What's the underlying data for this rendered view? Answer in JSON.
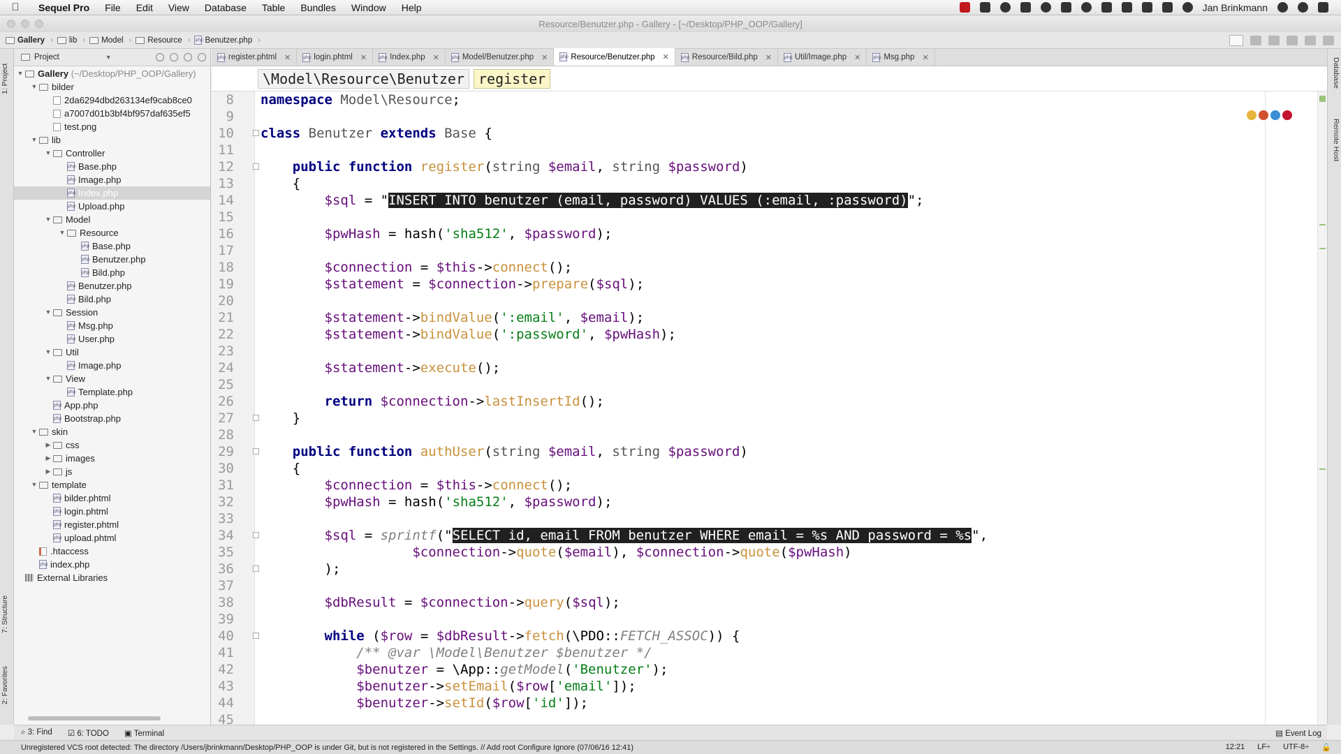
{
  "menubar": {
    "app_name": "Sequel Pro",
    "items": [
      "File",
      "Edit",
      "View",
      "Database",
      "Table",
      "Bundles",
      "Window",
      "Help"
    ],
    "user": "Jan Brinkmann"
  },
  "window": {
    "title": "Resource/Benutzer.php - Gallery - [~/Desktop/PHP_OOP/Gallery]"
  },
  "navbar": {
    "crumbs": [
      "Gallery",
      "lib",
      "Model",
      "Resource",
      "Benutzer.php"
    ]
  },
  "project": {
    "header": "Project",
    "root_label": "Gallery",
    "root_path": "(~/Desktop/PHP_OOP/Gallery)",
    "items": [
      {
        "label": "bilder",
        "kind": "folder",
        "arrow": "open"
      },
      {
        "label": "2da6294dbd263134ef9cab8ce0",
        "kind": "image",
        "arrow": ""
      },
      {
        "label": "a7007d01b3bf4bf957daf635ef5",
        "kind": "image",
        "arrow": ""
      },
      {
        "label": "test.png",
        "kind": "image",
        "arrow": ""
      },
      {
        "label": "lib",
        "kind": "folder",
        "arrow": "open"
      },
      {
        "label": "Controller",
        "kind": "folder",
        "arrow": "open"
      },
      {
        "label": "Base.php",
        "kind": "php",
        "arrow": ""
      },
      {
        "label": "Image.php",
        "kind": "php",
        "arrow": ""
      },
      {
        "label": "Index.php",
        "kind": "php",
        "arrow": ""
      },
      {
        "label": "Upload.php",
        "kind": "php",
        "arrow": ""
      },
      {
        "label": "Model",
        "kind": "folder",
        "arrow": "open"
      },
      {
        "label": "Resource",
        "kind": "folder",
        "arrow": "open"
      },
      {
        "label": "Base.php",
        "kind": "php",
        "arrow": ""
      },
      {
        "label": "Benutzer.php",
        "kind": "php",
        "arrow": ""
      },
      {
        "label": "Bild.php",
        "kind": "php",
        "arrow": ""
      },
      {
        "label": "Benutzer.php",
        "kind": "php",
        "arrow": ""
      },
      {
        "label": "Bild.php",
        "kind": "php",
        "arrow": ""
      },
      {
        "label": "Session",
        "kind": "folder",
        "arrow": "open"
      },
      {
        "label": "Msg.php",
        "kind": "php",
        "arrow": ""
      },
      {
        "label": "User.php",
        "kind": "php",
        "arrow": ""
      },
      {
        "label": "Util",
        "kind": "folder",
        "arrow": "open"
      },
      {
        "label": "Image.php",
        "kind": "php",
        "arrow": ""
      },
      {
        "label": "View",
        "kind": "folder",
        "arrow": "open"
      },
      {
        "label": "Template.php",
        "kind": "php",
        "arrow": ""
      },
      {
        "label": "App.php",
        "kind": "php",
        "arrow": ""
      },
      {
        "label": "Bootstrap.php",
        "kind": "php",
        "arrow": ""
      },
      {
        "label": "skin",
        "kind": "folder",
        "arrow": "open"
      },
      {
        "label": "css",
        "kind": "folder",
        "arrow": "closed"
      },
      {
        "label": "images",
        "kind": "folder",
        "arrow": "closed"
      },
      {
        "label": "js",
        "kind": "folder",
        "arrow": "closed"
      },
      {
        "label": "template",
        "kind": "folder",
        "arrow": "open"
      },
      {
        "label": "bilder.phtml",
        "kind": "php",
        "arrow": ""
      },
      {
        "label": "login.phtml",
        "kind": "php",
        "arrow": ""
      },
      {
        "label": "register.phtml",
        "kind": "php",
        "arrow": ""
      },
      {
        "label": "upload.phtml",
        "kind": "php",
        "arrow": ""
      },
      {
        "label": ".htaccess",
        "kind": "htaccess",
        "arrow": ""
      },
      {
        "label": "index.php",
        "kind": "php",
        "arrow": ""
      },
      {
        "label": "External Libraries",
        "kind": "ext",
        "arrow": ""
      }
    ]
  },
  "tabs": [
    {
      "label": "register.phtml"
    },
    {
      "label": "login.phtml"
    },
    {
      "label": "Index.php"
    },
    {
      "label": "Model/Benutzer.php"
    },
    {
      "label": "Resource/Benutzer.php"
    },
    {
      "label": "Resource/Bild.php"
    },
    {
      "label": "Util/Image.php"
    },
    {
      "label": "Msg.php"
    }
  ],
  "editor_breadcrumb": {
    "class_path": "\\Model\\Resource\\Benutzer",
    "method": "register"
  },
  "code": {
    "lines": [
      {
        "n": "8",
        "parts": [
          [
            "kw",
            "namespace "
          ],
          [
            "ty",
            "Model\\Resource"
          ],
          [
            "nm",
            ";"
          ]
        ]
      },
      {
        "n": "9",
        "parts": []
      },
      {
        "n": "10",
        "parts": [
          [
            "kw",
            "class "
          ],
          [
            "ty",
            "Benutzer "
          ],
          [
            "kw",
            "extends "
          ],
          [
            "ty",
            "Base "
          ],
          [
            "nm",
            "{"
          ]
        ]
      },
      {
        "n": "11",
        "parts": []
      },
      {
        "n": "12",
        "parts": [
          [
            "nm",
            "    "
          ],
          [
            "kw",
            "public function "
          ],
          [
            "fn",
            "register"
          ],
          [
            "nm",
            "("
          ],
          [
            "ty",
            "string "
          ],
          [
            "vr",
            "$email"
          ],
          [
            "nm",
            ", "
          ],
          [
            "ty",
            "string "
          ],
          [
            "vr",
            "$password"
          ],
          [
            "nm",
            ")"
          ]
        ]
      },
      {
        "n": "13",
        "parts": [
          [
            "nm",
            "    {"
          ]
        ]
      },
      {
        "n": "14",
        "parts": [
          [
            "nm",
            "        "
          ],
          [
            "vr",
            "$sql"
          ],
          [
            "nm",
            " = \""
          ],
          [
            "sel",
            "INSERT INTO benutzer (email, password) VALUES (:email, :password)"
          ],
          [
            "nm",
            "\";"
          ]
        ]
      },
      {
        "n": "15",
        "parts": []
      },
      {
        "n": "16",
        "parts": [
          [
            "nm",
            "        "
          ],
          [
            "vr",
            "$pwHash"
          ],
          [
            "nm",
            " = "
          ],
          [
            "nm",
            "hash"
          ],
          [
            "nm",
            "("
          ],
          [
            "st",
            "'sha512'"
          ],
          [
            "nm",
            ", "
          ],
          [
            "vr",
            "$password"
          ],
          [
            "nm",
            ");"
          ]
        ]
      },
      {
        "n": "17",
        "parts": []
      },
      {
        "n": "18",
        "parts": [
          [
            "nm",
            "        "
          ],
          [
            "vr",
            "$connection"
          ],
          [
            "nm",
            " = "
          ],
          [
            "vr",
            "$this"
          ],
          [
            "nm",
            "->"
          ],
          [
            "fn",
            "connect"
          ],
          [
            "nm",
            "();"
          ]
        ]
      },
      {
        "n": "19",
        "parts": [
          [
            "nm",
            "        "
          ],
          [
            "vr",
            "$statement"
          ],
          [
            "nm",
            " = "
          ],
          [
            "vr",
            "$connection"
          ],
          [
            "nm",
            "->"
          ],
          [
            "fn",
            "prepare"
          ],
          [
            "nm",
            "("
          ],
          [
            "vr",
            "$sql"
          ],
          [
            "nm",
            ");"
          ]
        ]
      },
      {
        "n": "20",
        "parts": []
      },
      {
        "n": "21",
        "parts": [
          [
            "nm",
            "        "
          ],
          [
            "vr",
            "$statement"
          ],
          [
            "nm",
            "->"
          ],
          [
            "fn",
            "bindValue"
          ],
          [
            "nm",
            "("
          ],
          [
            "st",
            "':email'"
          ],
          [
            "nm",
            ", "
          ],
          [
            "vr",
            "$email"
          ],
          [
            "nm",
            ");"
          ]
        ]
      },
      {
        "n": "22",
        "parts": [
          [
            "nm",
            "        "
          ],
          [
            "vr",
            "$statement"
          ],
          [
            "nm",
            "->"
          ],
          [
            "fn",
            "bindValue"
          ],
          [
            "nm",
            "("
          ],
          [
            "st",
            "':password'"
          ],
          [
            "nm",
            ", "
          ],
          [
            "vr",
            "$pwHash"
          ],
          [
            "nm",
            ");"
          ]
        ]
      },
      {
        "n": "23",
        "parts": []
      },
      {
        "n": "24",
        "parts": [
          [
            "nm",
            "        "
          ],
          [
            "vr",
            "$statement"
          ],
          [
            "nm",
            "->"
          ],
          [
            "fn",
            "execute"
          ],
          [
            "nm",
            "();"
          ]
        ]
      },
      {
        "n": "25",
        "parts": []
      },
      {
        "n": "26",
        "parts": [
          [
            "nm",
            "        "
          ],
          [
            "kw",
            "return "
          ],
          [
            "vr",
            "$connection"
          ],
          [
            "nm",
            "->"
          ],
          [
            "fn",
            "lastInsertId"
          ],
          [
            "nm",
            "();"
          ]
        ]
      },
      {
        "n": "27",
        "parts": [
          [
            "nm",
            "    }"
          ]
        ]
      },
      {
        "n": "28",
        "parts": []
      },
      {
        "n": "29",
        "parts": [
          [
            "nm",
            "    "
          ],
          [
            "kw",
            "public function "
          ],
          [
            "fn",
            "authUser"
          ],
          [
            "nm",
            "("
          ],
          [
            "ty",
            "string "
          ],
          [
            "vr",
            "$email"
          ],
          [
            "nm",
            ", "
          ],
          [
            "ty",
            "string "
          ],
          [
            "vr",
            "$password"
          ],
          [
            "nm",
            ")"
          ]
        ]
      },
      {
        "n": "30",
        "parts": [
          [
            "nm",
            "    {"
          ]
        ]
      },
      {
        "n": "31",
        "parts": [
          [
            "nm",
            "        "
          ],
          [
            "vr",
            "$connection"
          ],
          [
            "nm",
            " = "
          ],
          [
            "vr",
            "$this"
          ],
          [
            "nm",
            "->"
          ],
          [
            "fn",
            "connect"
          ],
          [
            "nm",
            "();"
          ]
        ]
      },
      {
        "n": "32",
        "parts": [
          [
            "nm",
            "        "
          ],
          [
            "vr",
            "$pwHash"
          ],
          [
            "nm",
            " = "
          ],
          [
            "nm",
            "hash"
          ],
          [
            "nm",
            "("
          ],
          [
            "st",
            "'sha512'"
          ],
          [
            "nm",
            ", "
          ],
          [
            "vr",
            "$password"
          ],
          [
            "nm",
            ");"
          ]
        ]
      },
      {
        "n": "33",
        "parts": []
      },
      {
        "n": "34",
        "parts": [
          [
            "nm",
            "        "
          ],
          [
            "vr",
            "$sql"
          ],
          [
            "nm",
            " = "
          ],
          [
            "cm",
            "sprintf"
          ],
          [
            "nm",
            "(\""
          ],
          [
            "sel",
            "SELECT id, email FROM benutzer WHERE email = %s AND password = %s"
          ],
          [
            "nm",
            "\","
          ]
        ]
      },
      {
        "n": "35",
        "parts": [
          [
            "nm",
            "                   "
          ],
          [
            "vr",
            "$connection"
          ],
          [
            "nm",
            "->"
          ],
          [
            "fn",
            "quote"
          ],
          [
            "nm",
            "("
          ],
          [
            "vr",
            "$email"
          ],
          [
            "nm",
            "), "
          ],
          [
            "vr",
            "$connection"
          ],
          [
            "nm",
            "->"
          ],
          [
            "fn",
            "quote"
          ],
          [
            "nm",
            "("
          ],
          [
            "vr",
            "$pwHash"
          ],
          [
            "nm",
            ")"
          ]
        ]
      },
      {
        "n": "36",
        "parts": [
          [
            "nm",
            "        );"
          ]
        ]
      },
      {
        "n": "37",
        "parts": []
      },
      {
        "n": "38",
        "parts": [
          [
            "nm",
            "        "
          ],
          [
            "vr",
            "$dbResult"
          ],
          [
            "nm",
            " = "
          ],
          [
            "vr",
            "$connection"
          ],
          [
            "nm",
            "->"
          ],
          [
            "fn",
            "query"
          ],
          [
            "nm",
            "("
          ],
          [
            "vr",
            "$sql"
          ],
          [
            "nm",
            ");"
          ]
        ]
      },
      {
        "n": "39",
        "parts": []
      },
      {
        "n": "40",
        "parts": [
          [
            "nm",
            "        "
          ],
          [
            "kw",
            "while "
          ],
          [
            "nm",
            "("
          ],
          [
            "vr",
            "$row"
          ],
          [
            "nm",
            " = "
          ],
          [
            "vr",
            "$dbResult"
          ],
          [
            "nm",
            "->"
          ],
          [
            "fn",
            "fetch"
          ],
          [
            "nm",
            "(\\PDO::"
          ],
          [
            "cm",
            "FETCH_ASSOC"
          ],
          [
            "nm",
            ")) {"
          ]
        ]
      },
      {
        "n": "41",
        "parts": [
          [
            "nm",
            "            "
          ],
          [
            "cm",
            "/** @var \\Model\\Benutzer $benutzer */"
          ]
        ]
      },
      {
        "n": "42",
        "parts": [
          [
            "nm",
            "            "
          ],
          [
            "vr",
            "$benutzer"
          ],
          [
            "nm",
            " = \\App::"
          ],
          [
            "cm",
            "getModel"
          ],
          [
            "nm",
            "("
          ],
          [
            "st",
            "'Benutzer'"
          ],
          [
            "nm",
            ");"
          ]
        ]
      },
      {
        "n": "43",
        "parts": [
          [
            "nm",
            "            "
          ],
          [
            "vr",
            "$benutzer"
          ],
          [
            "nm",
            "->"
          ],
          [
            "fn",
            "setEmail"
          ],
          [
            "nm",
            "("
          ],
          [
            "vr",
            "$row"
          ],
          [
            "nm",
            "["
          ],
          [
            "st",
            "'email'"
          ],
          [
            "nm",
            "]);"
          ]
        ]
      },
      {
        "n": "44",
        "parts": [
          [
            "nm",
            "            "
          ],
          [
            "vr",
            "$benutzer"
          ],
          [
            "nm",
            "->"
          ],
          [
            "fn",
            "setId"
          ],
          [
            "nm",
            "("
          ],
          [
            "vr",
            "$row"
          ],
          [
            "nm",
            "["
          ],
          [
            "st",
            "'id'"
          ],
          [
            "nm",
            "]);"
          ]
        ]
      },
      {
        "n": "45",
        "parts": []
      }
    ]
  },
  "tool_windows": {
    "left": [
      "1: Project",
      "7: Structure",
      "2: Favorites"
    ],
    "right": [
      "Database",
      "Remote Host"
    ],
    "bottom": [
      "3: Find",
      "6: TODO",
      "Terminal"
    ],
    "event_log": "Event Log"
  },
  "status": {
    "message": "Unregistered VCS root detected: The directory /Users/jbrinkmann/Desktop/PHP_OOP is under Git, but is not registered in the Settings. // Add root  Configure  Ignore (07/06/16 12:41)",
    "position": "12:21",
    "line_sep": "LF÷",
    "encoding": "UTF-8÷"
  }
}
